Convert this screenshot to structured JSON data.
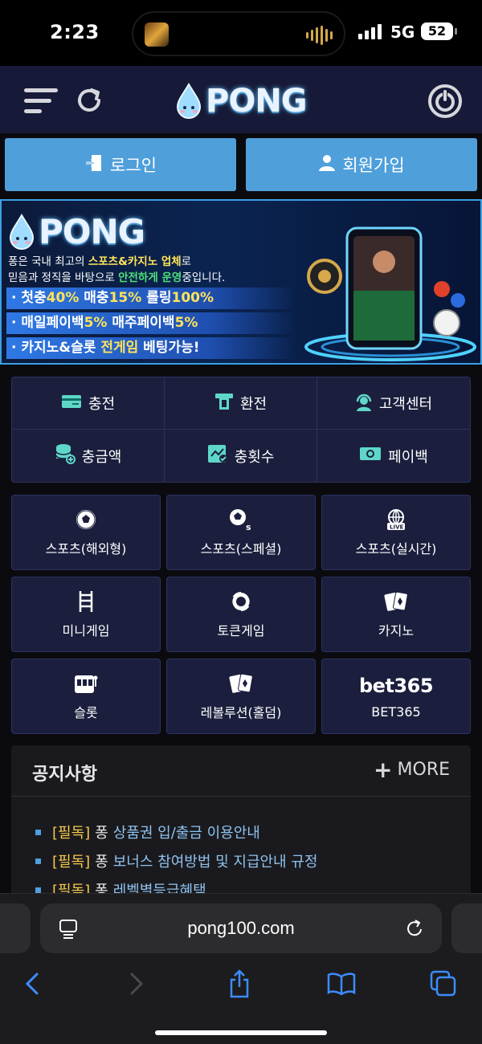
{
  "status_bar": {
    "time": "2:23",
    "network": "5G",
    "battery": "52"
  },
  "header": {
    "logo_text": "PONG"
  },
  "auth": {
    "login_label": "로그인",
    "join_label": "회원가입"
  },
  "banner": {
    "logo_text": "PONG",
    "desc_line1_a": "퐁은 국내 최고의 ",
    "desc_line1_b": "스포츠&카지노 업체",
    "desc_line1_c": "로",
    "desc_line2_a": "믿음과 정직을 바탕으로 ",
    "desc_line2_b": "안전하게 운영",
    "desc_line2_c": "중입니다.",
    "promo1_a": "· 첫충",
    "promo1_b": "40%",
    "promo1_c": " 매충",
    "promo1_d": "15%",
    "promo1_e": " 롤링",
    "promo1_f": "100%",
    "promo2_a": "· 매일페이백",
    "promo2_b": "5%",
    "promo2_c": " 매주페이백",
    "promo2_d": "5%",
    "promo3_a": "· 카지노&슬롯 ",
    "promo3_b": "전게임",
    "promo3_c": " 베팅가능!"
  },
  "quick_menu": [
    {
      "label": "충전",
      "icon": "card-icon"
    },
    {
      "label": "환전",
      "icon": "atm-icon"
    },
    {
      "label": "고객센터",
      "icon": "headset-icon"
    },
    {
      "label": "충금액",
      "icon": "coins-icon"
    },
    {
      "label": "충횟수",
      "icon": "chart-check-icon"
    },
    {
      "label": "페이백",
      "icon": "cash-icon"
    }
  ],
  "games": [
    {
      "label": "스포츠(해외형)",
      "icon": "soccer-ball-icon"
    },
    {
      "label": "스포츠(스페셜)",
      "icon": "soccer-special-icon"
    },
    {
      "label": "스포츠(실시간)",
      "icon": "live-globe-icon"
    },
    {
      "label": "미니게임",
      "icon": "ladder-icon"
    },
    {
      "label": "토큰게임",
      "icon": "token-ring-icon"
    },
    {
      "label": "카지노",
      "icon": "cards-icon"
    },
    {
      "label": "슬롯",
      "icon": "slot-machine-icon"
    },
    {
      "label": "레볼루션(홀덤)",
      "icon": "cards-icon"
    },
    {
      "label": "BET365",
      "icon": "bet365-logo",
      "logo_text": "bet365"
    }
  ],
  "notice": {
    "title": "공지사항",
    "more_label": "MORE",
    "items": [
      {
        "tag": "[필독]",
        "prefix": "퐁",
        "text": "상품권 입/출금 이용안내"
      },
      {
        "tag": "[필독]",
        "prefix": "퐁",
        "text": "보너스 참여방법 및 지급안내 규정"
      },
      {
        "tag": "[필독]",
        "prefix": "퐁",
        "text": "레벨별등급혜택"
      }
    ]
  },
  "browser": {
    "url": "pong100.com"
  }
}
